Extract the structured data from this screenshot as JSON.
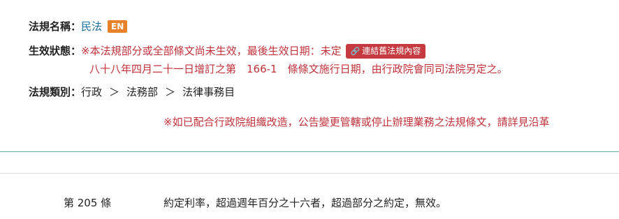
{
  "law_name": {
    "label": "法規名稱：",
    "value": "民法",
    "en_badge": "EN"
  },
  "effective_status": {
    "label": "生效狀態：",
    "line1": "※本法規部分或全部條文尚未生效，最後生效日期：未定",
    "link_button": "連結舊法規內容",
    "link_icon": "link-icon",
    "line2": "八十八年四月二十一日增訂之第　166-1　條條文施行日期，由行政院會同司法院另定之。"
  },
  "category": {
    "label": "法規類別：",
    "crumbs": [
      "行政",
      "法務部",
      "法律事務目"
    ],
    "separator": "＞"
  },
  "notice": "※如已配合行政院組織改造，公告變更管轄或停止辦理業務之法規條文，請詳見沿革",
  "article": {
    "number": "第 205 條",
    "text": "約定利率，超過週年百分之十六者，超過部分之約定，無效。"
  },
  "colors": {
    "accent_red": "#c0313a",
    "badge_orange": "#e8822a",
    "link_blue": "#1a6f9e",
    "panel_border": "#6aa8b0"
  }
}
